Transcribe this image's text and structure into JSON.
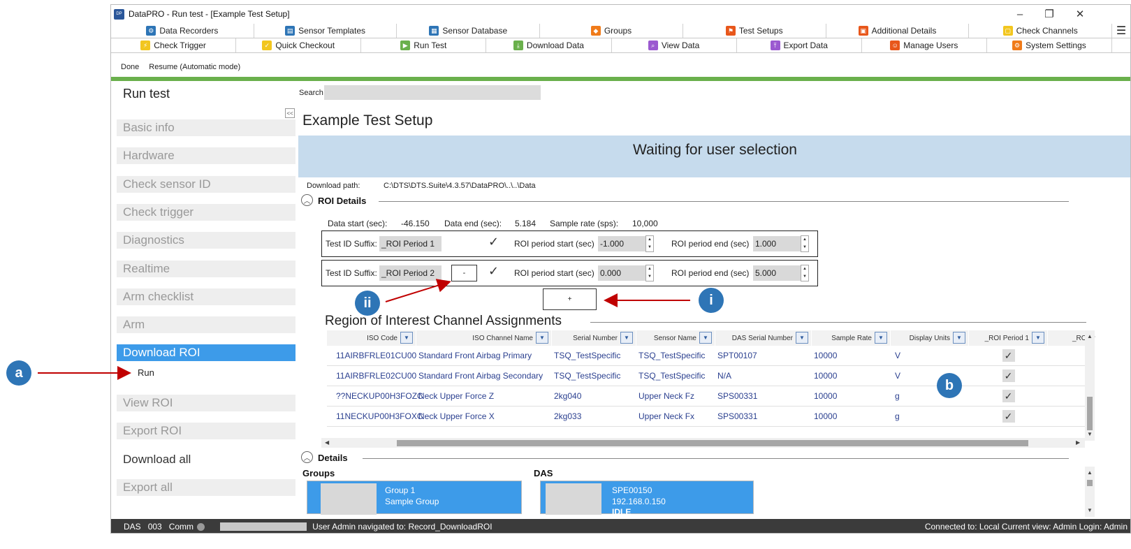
{
  "window": {
    "title": "DataPRO - Run test - [Example Test Setup]",
    "app_icon_text": "DataPRO",
    "minimize": "–",
    "restore": "❐",
    "close": "✕"
  },
  "tabs_row1": [
    {
      "label": "Data Recorders",
      "icon": "data-recorders-icon",
      "color": "#2e75b6"
    },
    {
      "label": "Sensor Templates",
      "icon": "sensor-templates-icon",
      "color": "#2e75b6"
    },
    {
      "label": "Sensor Database",
      "icon": "sensor-database-icon",
      "color": "#2e75b6"
    },
    {
      "label": "Groups",
      "icon": "groups-icon",
      "color": "#f07b1a"
    },
    {
      "label": "Test Setups",
      "icon": "test-setups-icon",
      "color": "#e8571b"
    },
    {
      "label": "Additional Details",
      "icon": "additional-details-icon",
      "color": "#e8571b"
    },
    {
      "label": "Check Channels",
      "icon": "check-channels-icon",
      "color": "#f2c61f"
    }
  ],
  "tabs_row2": [
    {
      "label": "Check Trigger",
      "icon": "check-trigger-icon",
      "color": "#f2c61f"
    },
    {
      "label": "Quick Checkout",
      "icon": "quick-checkout-icon",
      "color": "#f2c61f"
    },
    {
      "label": "Run Test",
      "icon": "run-test-icon",
      "color": "#6ab04c"
    },
    {
      "label": "Download Data",
      "icon": "download-data-icon",
      "color": "#6ab04c"
    },
    {
      "label": "View Data",
      "icon": "view-data-icon",
      "color": "#9b59d0"
    },
    {
      "label": "Export Data",
      "icon": "export-data-icon",
      "color": "#9b59d0"
    },
    {
      "label": "Manage Users",
      "icon": "manage-users-icon",
      "color": "#e8571b"
    },
    {
      "label": "System Settings",
      "icon": "system-settings-icon",
      "color": "#f07b1a"
    }
  ],
  "toolbar": {
    "done": "Done",
    "resume": "Resume (Automatic mode)"
  },
  "nav": {
    "title": "Run test",
    "collapse": "<<",
    "items": [
      "Basic info",
      "Hardware",
      "Check sensor ID",
      "Check trigger",
      "Diagnostics",
      "Realtime",
      "Arm checklist",
      "Arm",
      "Download ROI",
      "View ROI",
      "Export ROI",
      "Download all",
      "Export all"
    ],
    "sub_item": "Run"
  },
  "search": {
    "label": "Search",
    "value": ""
  },
  "setup_title": "Example Test Setup",
  "banner": "Waiting for user selection",
  "download": {
    "label": "Download path:",
    "value": "C:\\DTS\\DTS.Suite\\4.3.57\\DataPRO\\..\\..\\Data"
  },
  "roi": {
    "section_title": "ROI Details",
    "data_start_label": "Data start (sec):",
    "data_start": "-46.150",
    "data_end_label": "Data end (sec):",
    "data_end": "5.184",
    "sample_rate_label": "Sample rate (sps):",
    "sample_rate": "10,000",
    "suffix_label": "Test ID Suffix:",
    "start_label": "ROI period start (sec)",
    "end_label": "ROI period end (sec)",
    "check": "✓",
    "minus": "-",
    "plus": "+",
    "periods": [
      {
        "suffix": "_ROI Period 1",
        "start": "-1.000",
        "end": "1.000"
      },
      {
        "suffix": "_ROI Period 2",
        "start": "0.000",
        "end": "5.000"
      }
    ]
  },
  "region": {
    "title": "Region of Interest Channel Assignments",
    "filter_icon": "▼",
    "headers": [
      "ISO Code",
      "ISO Channel Name",
      "Serial Number",
      "Sensor Name",
      "DAS Serial Number",
      "Sample Rate",
      "Display Units",
      "_ROI Period 1",
      "_ROI P"
    ],
    "rows": [
      [
        "11AIRBFRLE01CU00",
        "Standard Front Airbag Primary",
        "TSQ_TestSpecific",
        "TSQ_TestSpecific",
        "SPT00107",
        "10000",
        "V"
      ],
      [
        "11AIRBFRLE02CU00",
        "Standard Front Airbag Secondary",
        "TSQ_TestSpecific",
        "TSQ_TestSpecific",
        "N/A",
        "10000",
        "V"
      ],
      [
        "??NECKUP00H3FOZC",
        "Neck Upper Force Z",
        "2kg040",
        "Upper Neck Fz",
        "SPS00331",
        "10000",
        "g"
      ],
      [
        "11NECKUP00H3FOXC",
        "Neck Upper Force X",
        "2kg033",
        "Upper Neck Fx",
        "SPS00331",
        "10000",
        "g"
      ]
    ]
  },
  "details": {
    "section_title": "Details",
    "groups_label": "Groups",
    "das_label": "DAS",
    "group_card": {
      "line1": "Group 1",
      "line2": "Sample Group"
    },
    "das_card": {
      "line1": "SPE00150",
      "line2": "192.168.0.150",
      "line3": "IDLE"
    }
  },
  "status": {
    "das": "DAS",
    "count": "003",
    "comm": "Comm",
    "message": "User Admin navigated to: Record_DownloadROI",
    "right": "Connected to:  Local   Current view: Admin  Login: Admin"
  },
  "callouts": {
    "a": "a",
    "b": "b",
    "i": "i",
    "ii": "ii"
  },
  "colors": {
    "accent": "#3d9be9",
    "green_bar": "#6ab04c",
    "banner": "#c6dbed",
    "callout": "#2e75b6",
    "arrow": "#c00000"
  }
}
